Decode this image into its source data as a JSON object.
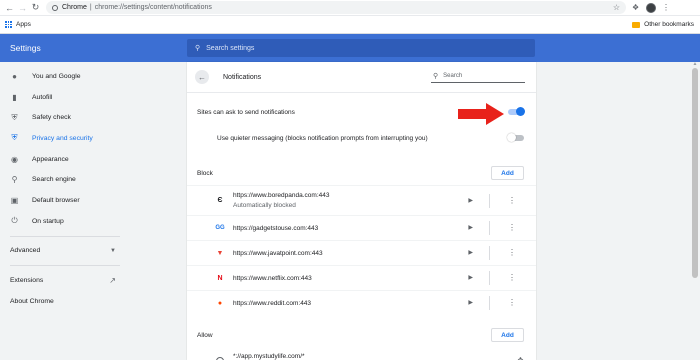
{
  "browser": {
    "host_label": "Chrome",
    "url": "chrome://settings/content/notifications"
  },
  "bookmarks": {
    "apps_label": "Apps",
    "other_label": "Other bookmarks"
  },
  "settings": {
    "title": "Settings",
    "search_placeholder": "Search settings"
  },
  "sidebar": {
    "items": [
      {
        "label": "You and Google",
        "icon": "person-icon"
      },
      {
        "label": "Autofill",
        "icon": "clipboard-icon"
      },
      {
        "label": "Safety check",
        "icon": "shield-icon"
      },
      {
        "label": "Privacy and security",
        "icon": "shield-lock-icon",
        "active": true
      },
      {
        "label": "Appearance",
        "icon": "palette-icon"
      },
      {
        "label": "Search engine",
        "icon": "search-icon"
      },
      {
        "label": "Default browser",
        "icon": "browser-icon"
      },
      {
        "label": "On startup",
        "icon": "power-icon"
      }
    ],
    "advanced_label": "Advanced",
    "extensions_label": "Extensions",
    "about_label": "About Chrome"
  },
  "notifications": {
    "title": "Notifications",
    "search_placeholder": "Search",
    "ask_label": "Sites can ask to send notifications",
    "ask_enabled": true,
    "quieter_label": "Use quieter messaging (blocks notification prompts from interrupting you)",
    "quieter_enabled": false,
    "block_heading": "Block",
    "allow_heading": "Allow",
    "add_label": "Add",
    "blocked_sites": [
      {
        "url": "https://www.boredpanda.com:443",
        "sub": "Automatically blocked",
        "icon": "boredpanda-icon"
      },
      {
        "url": "https://gadgetstouse.com:443",
        "sub": "",
        "icon": "gadgetstouse-icon"
      },
      {
        "url": "https://www.javatpoint.com:443",
        "sub": "",
        "icon": "javatpoint-icon"
      },
      {
        "url": "https://www.netflix.com:443",
        "sub": "",
        "icon": "netflix-icon"
      },
      {
        "url": "https://www.reddit.com:443",
        "sub": "",
        "icon": "reddit-icon"
      }
    ],
    "allowed_sites": [
      {
        "url": "*://app.mystudylife.com/*",
        "icon": "globe-icon"
      }
    ]
  },
  "colors": {
    "header_blue": "#3c6fd3",
    "accent": "#1a73e8",
    "annotation_red": "#e8221b"
  }
}
